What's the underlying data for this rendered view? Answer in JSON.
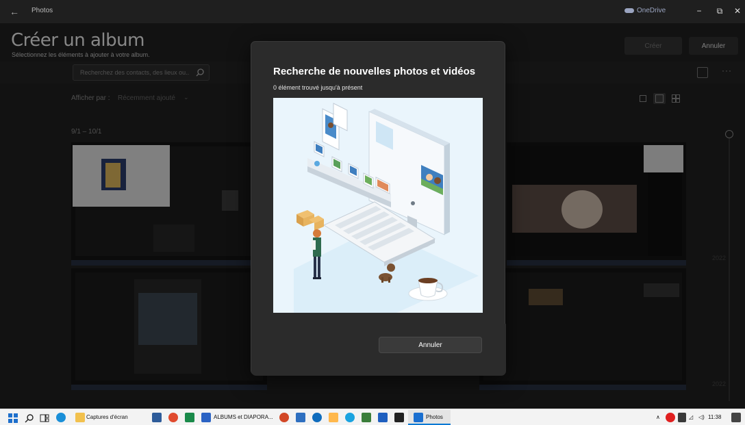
{
  "window": {
    "app_title": "Photos",
    "onedrive_label": "OneDrive",
    "controls": {
      "minimize": "−",
      "restore": "⧉",
      "close": "✕"
    }
  },
  "page": {
    "heading": "Créer un album",
    "subtitle": "Sélectionnez les éléments à ajouter à votre album.",
    "create_label": "Créer",
    "cancel_label": "Annuler"
  },
  "search": {
    "placeholder": "Recherchez des contacts, des lieux ou..."
  },
  "view": {
    "label": "Afficher par :",
    "value": "Récemment ajouté",
    "chevron": "⌄"
  },
  "date_group": {
    "range": "9/1 – 10/1"
  },
  "timeline": {
    "year_top": "2022",
    "year_bottom": "2022"
  },
  "dialog": {
    "title": "Recherche de nouvelles photos et vidéos",
    "status": "0 élément trouvé jusqu'à présent",
    "cancel_label": "Annuler"
  },
  "taskbar": {
    "items": [
      {
        "name": "file-explorer",
        "label": "Captures d'écran"
      },
      {
        "name": "powerpoint",
        "label": "ALBUMS et DIAPORA..."
      },
      {
        "name": "photos",
        "label": "Photos"
      }
    ],
    "time": "11:38"
  },
  "colors": {
    "accent": "#0078d4",
    "dialog_bg": "#2b2b2b",
    "app_bg": "#202020",
    "illustration_bg": "#eaf5fc"
  },
  "icons": [
    "back-arrow-icon",
    "onedrive-cloud-icon",
    "search-icon",
    "filter-icon",
    "more-icon",
    "windows-start-icon",
    "taskbar-search-icon",
    "task-view-icon",
    "edge-icon",
    "folder-icon",
    "chrome-icon",
    "powerpoint-icon",
    "photos-icon"
  ]
}
